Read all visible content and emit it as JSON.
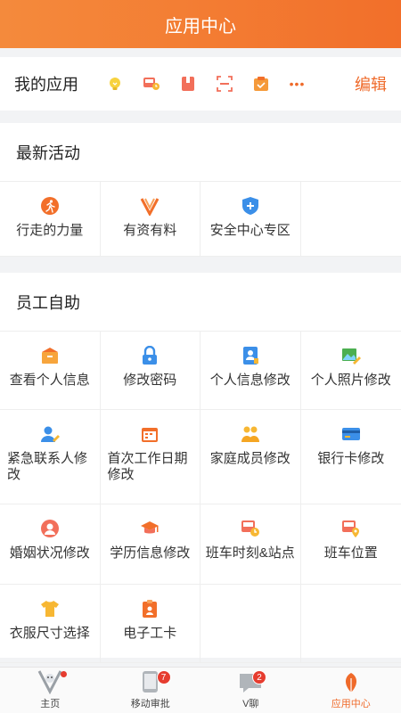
{
  "header": {
    "title": "应用中心"
  },
  "myapps": {
    "title": "我的应用",
    "edit": "编辑",
    "more": "•••"
  },
  "activities": {
    "title": "最新活动",
    "items": [
      {
        "label": "行走的力量",
        "icon": "run-icon"
      },
      {
        "label": "有资有料",
        "icon": "v-logo-icon"
      },
      {
        "label": "安全中心专区",
        "icon": "shield-plus-icon"
      }
    ]
  },
  "selfservice": {
    "title": "员工自助",
    "items": [
      {
        "label": "查看个人信息",
        "icon": "info-box-icon"
      },
      {
        "label": "修改密码",
        "icon": "lock-icon"
      },
      {
        "label": "个人信息修改",
        "icon": "contact-book-icon"
      },
      {
        "label": "个人照片修改",
        "icon": "photo-edit-icon"
      },
      {
        "label": "紧急联系人修改",
        "icon": "person-edit-icon"
      },
      {
        "label": "首次工作日期修改",
        "icon": "calendar-icon"
      },
      {
        "label": "家庭成员修改",
        "icon": "family-icon"
      },
      {
        "label": "银行卡修改",
        "icon": "bank-card-icon"
      },
      {
        "label": "婚姻状况修改",
        "icon": "marriage-icon"
      },
      {
        "label": "学历信息修改",
        "icon": "graduation-cap-icon"
      },
      {
        "label": "班车时刻&站点",
        "icon": "bus-clock-icon"
      },
      {
        "label": "班车位置",
        "icon": "bus-location-icon"
      },
      {
        "label": "衣服尺寸选择",
        "icon": "shirt-icon"
      },
      {
        "label": "电子工卡",
        "icon": "badge-card-icon"
      }
    ]
  },
  "tabs": [
    {
      "label": "主页",
      "icon": "home-logo-icon"
    },
    {
      "label": "移动审批",
      "icon": "phone-approval-icon",
      "badge": "7"
    },
    {
      "label": "V聊",
      "icon": "chat-icon",
      "badge": "2"
    },
    {
      "label": "应用中心",
      "icon": "app-center-icon",
      "active": true
    }
  ],
  "colors": {
    "accent": "#ef6a2a",
    "header_start": "#f48a3c",
    "header_end": "#f26f2a",
    "badge": "#e63c2f"
  }
}
